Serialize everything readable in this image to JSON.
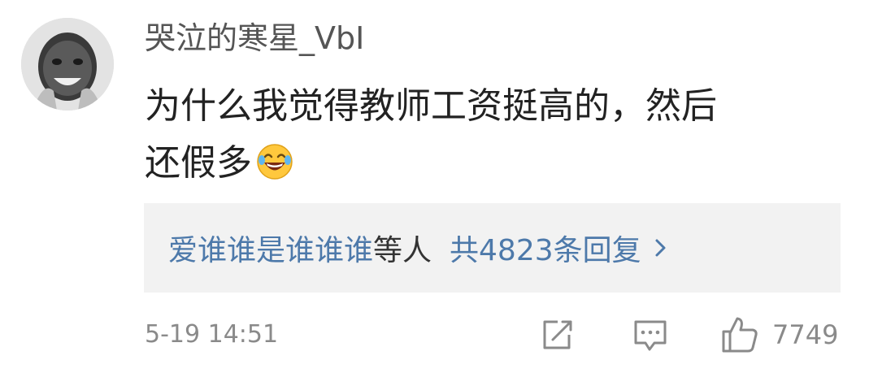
{
  "comment": {
    "username": "哭泣的寒星_VbI",
    "text_line1": "为什么我觉得教师工资挺高的，然后",
    "text_line2": "还假多",
    "emoji": "laughing-with-tears",
    "timestamp": "5-19 14:51",
    "likes": "7749"
  },
  "replies": {
    "names": "爱谁谁是谁谁谁",
    "suffix": "等人",
    "count_text": "共4823条回复"
  },
  "colors": {
    "link_blue": "#4d79aa",
    "reply_bg": "#f2f2f2",
    "meta_gray": "#8a8a8a"
  }
}
